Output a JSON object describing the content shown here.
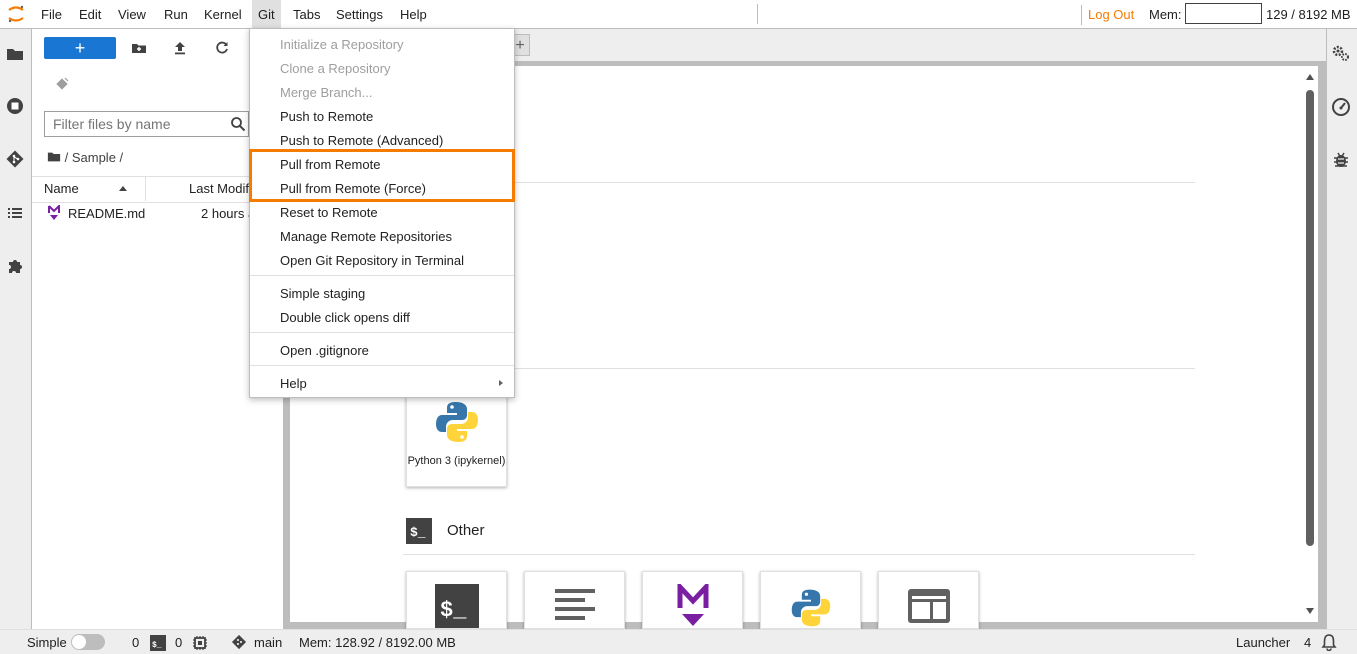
{
  "menubar": {
    "items": [
      "File",
      "Edit",
      "View",
      "Run",
      "Kernel",
      "Git",
      "Tabs",
      "Settings",
      "Help"
    ],
    "active": "Git"
  },
  "topbar": {
    "logout": "Log Out",
    "mem_label": "Mem:",
    "mem_value": "129 / 8192 MB"
  },
  "filebrowser": {
    "new_label": "+",
    "filter_placeholder": "Filter files by name",
    "breadcrumb": "/ Sample /",
    "columns": {
      "name": "Name",
      "modified": "Last Modified"
    },
    "files": [
      {
        "name": "README.md",
        "modified": "2 hours ago",
        "icon": "markdown-icon"
      }
    ]
  },
  "launcher": {
    "kernel_card": {
      "label": "Python 3 (ipykernel)"
    },
    "other_section": "Other"
  },
  "git_menu": {
    "items": [
      {
        "label": "Initialize a Repository",
        "disabled": true
      },
      {
        "label": "Clone a Repository",
        "disabled": true
      },
      {
        "label": "Merge Branch...",
        "disabled": true
      },
      {
        "label": "Push to Remote",
        "disabled": false
      },
      {
        "label": "Push to Remote (Advanced)",
        "disabled": false
      },
      {
        "label": "Pull from Remote",
        "disabled": false
      },
      {
        "label": "Pull from Remote (Force)",
        "disabled": false
      },
      {
        "label": "Reset to Remote",
        "disabled": false
      },
      {
        "label": "Manage Remote Repositories",
        "disabled": false
      },
      {
        "label": "Open Git Repository in Terminal",
        "disabled": false
      },
      {
        "label": "Simple staging",
        "disabled": false
      },
      {
        "label": "Double click opens diff",
        "disabled": false
      },
      {
        "label": "Open .gitignore",
        "disabled": false
      },
      {
        "label": "Help",
        "disabled": false
      }
    ]
  },
  "statusbar": {
    "simple": "Simple",
    "terminals": "0",
    "kernels": "0",
    "branch": "main",
    "mem": "Mem: 128.92 / 8192.00 MB",
    "launcher": "Launcher",
    "notifications": "4"
  },
  "colors": {
    "accent_blue": "#1976d2",
    "highlight_orange": "#f57c00",
    "logout_orange": "#f57c00"
  }
}
